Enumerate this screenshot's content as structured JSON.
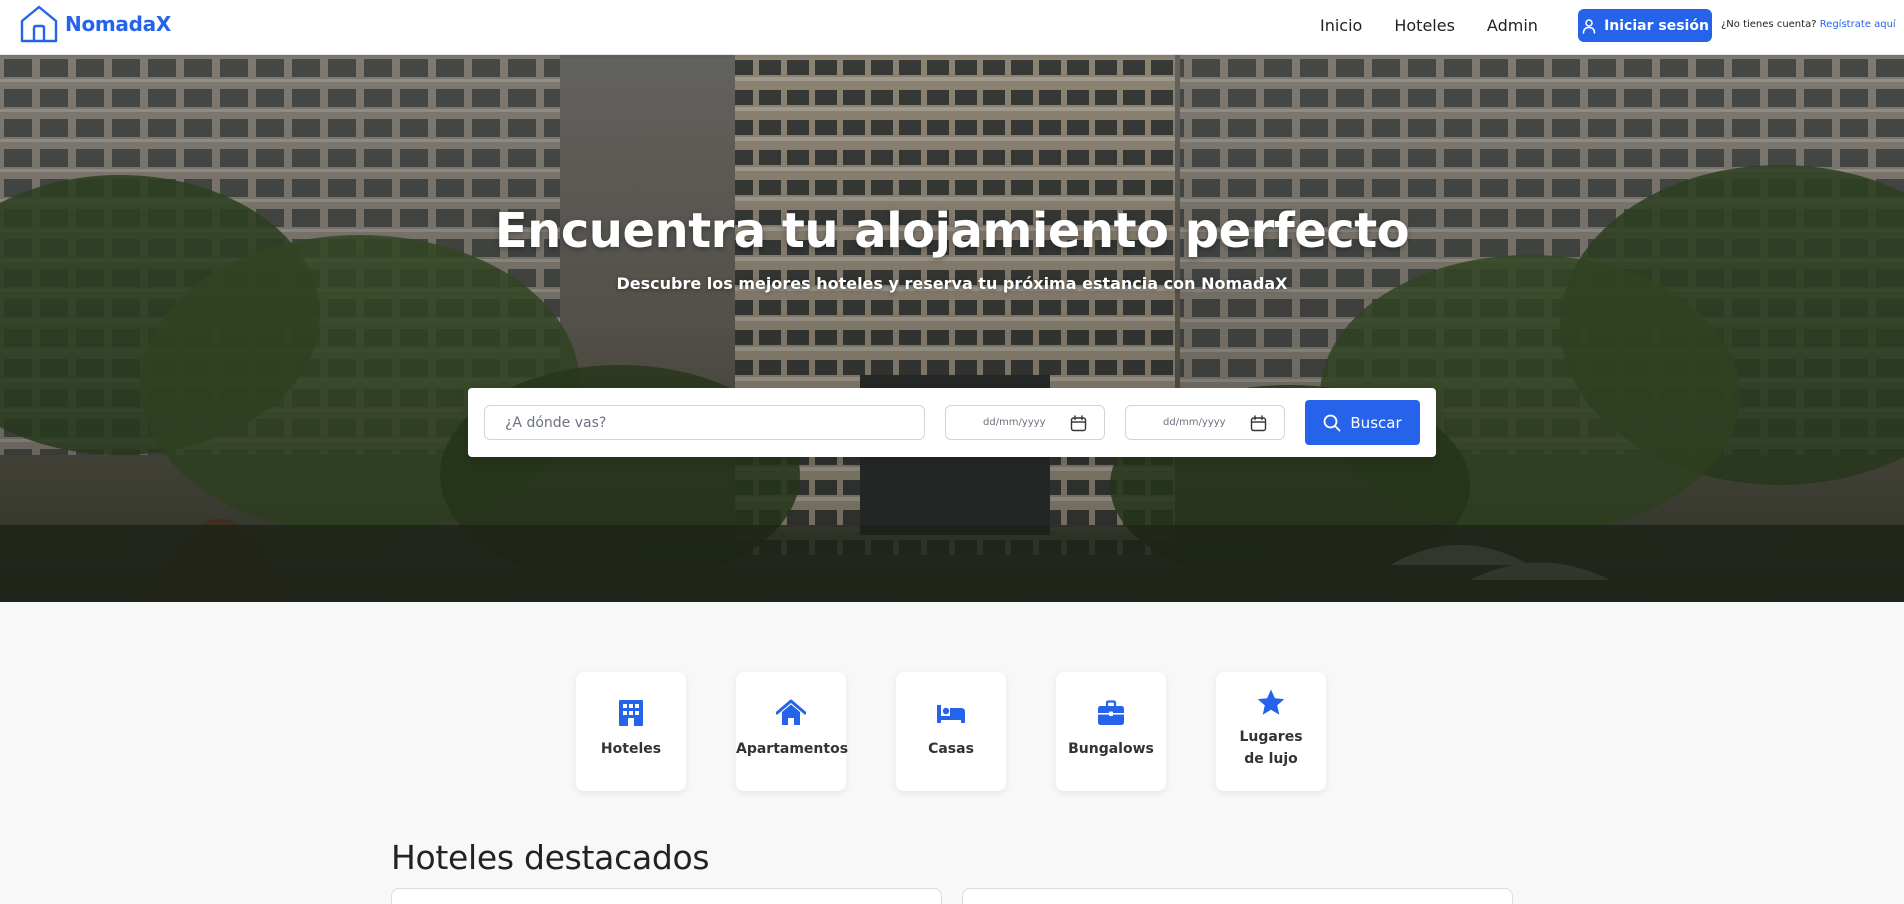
{
  "brand": {
    "name": "NomadaX",
    "icon": "house-icon",
    "color": "#2563eb"
  },
  "nav": {
    "links": [
      "Inicio",
      "Hoteles",
      "Admin"
    ],
    "login_label": "Iniciar sesión",
    "login_icon": "user-icon",
    "register_prompt": "¿No tienes cuenta?",
    "register_link": "Regístrate aquí"
  },
  "hero": {
    "title": "Encuentra tu alojamiento perfecto",
    "subtitle": "Descubre los mejores hoteles y reserva tu próxima estancia con NomadaX"
  },
  "search": {
    "destination_placeholder": "¿A dónde vas?",
    "destination_value": "",
    "checkin_placeholder": "dd/mm/yyyy",
    "checkout_placeholder": "dd/mm/yyyy",
    "button_label": "Buscar",
    "button_icon": "search-icon"
  },
  "categories": [
    {
      "label": "Hoteles",
      "icon": "building-icon"
    },
    {
      "label": "Apartamentos",
      "icon": "home-icon"
    },
    {
      "label": "Casas",
      "icon": "bed-icon"
    },
    {
      "label": "Bungalows",
      "icon": "briefcase-icon"
    },
    {
      "label": "Lugares de lujo",
      "icon": "star-icon"
    }
  ],
  "featured": {
    "title": "Hoteles destacados"
  },
  "colors": {
    "accent": "#2563eb",
    "background": "#f8f8f8"
  }
}
